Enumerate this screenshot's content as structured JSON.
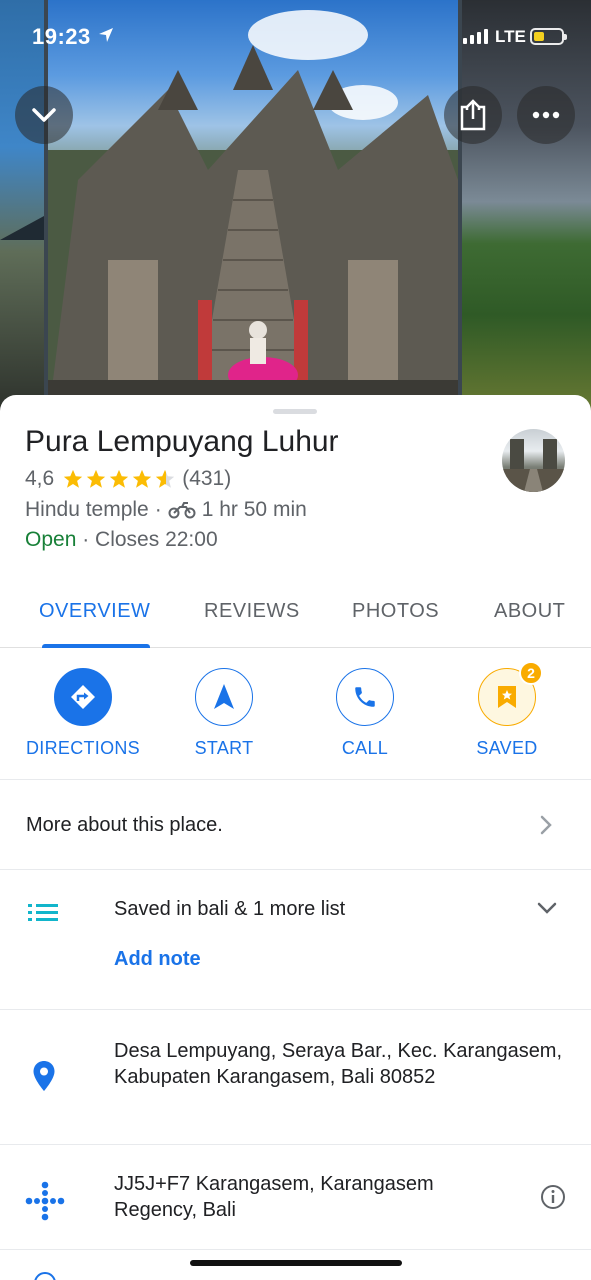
{
  "status_bar": {
    "time": "19:23",
    "network": "LTE",
    "battery_color": "#f4d01f"
  },
  "header": {
    "collapse_icon": "chevron-down-icon",
    "share_icon": "share-icon",
    "more_icon": "more-horizontal-icon"
  },
  "place": {
    "name": "Pura Lempuyang Luhur",
    "rating": "4,6",
    "stars": 4.6,
    "review_count": "(431)",
    "category": "Hindu temple",
    "separator": "·",
    "travel_time": "1 hr 50 min",
    "status": "Open",
    "hours": "· Closes 22:00"
  },
  "tabs": [
    "OVERVIEW",
    "REVIEWS",
    "PHOTOS",
    "ABOUT"
  ],
  "actions": {
    "directions": "DIRECTIONS",
    "start": "START",
    "call": "CALL",
    "saved": "SAVED",
    "saved_badge": "2"
  },
  "rows": {
    "more_about": "More about this place.",
    "saved_in": "Saved in bali & 1 more list",
    "add_note": "Add note",
    "address": "Desa Lempuyang, Seraya Bar., Kec. Karangasem, Kabupaten Karangasem, Bali 80852",
    "plus_code": "JJ5J+F7 Karangasem, Karangasem Regency, Bali"
  },
  "colors": {
    "accent": "#1a73e8",
    "open": "#188038",
    "star": "#fbbc04",
    "saved": "#f9ab00"
  }
}
